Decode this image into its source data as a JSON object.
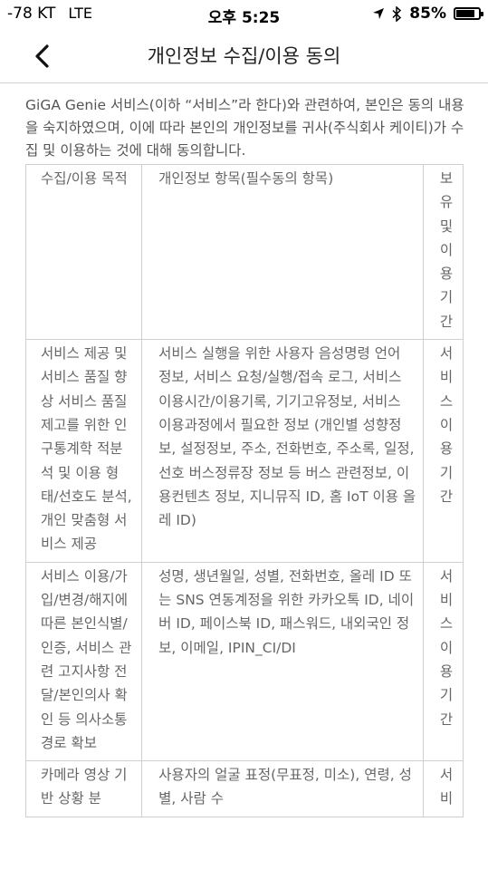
{
  "status_bar": {
    "signal": "-78 KT",
    "network": "LTE",
    "time": "오후 5:25",
    "battery": "85%",
    "battery_level": 0.85
  },
  "nav": {
    "title": "개인정보 수집/이용 동의"
  },
  "intro": "GiGA Genie 서비스(이하 “서비스”라 한다)와 관련하여, 본인은 동의 내용을 숙지하였으며, 이에 따라 본인의 개인정보를 귀사(주식회사 케이티)가 수집 및 이용하는 것에 대해 동의합니다.",
  "table": {
    "headers": [
      "수집/이용 목적",
      "개인정보 항목(필수동의 항목)",
      "보유 및 이용 기간"
    ],
    "rows": [
      {
        "purpose": "서비스 제공 및 서비스 품질 향상 서비스 품질 제고를 위한 인구통계학 적분석 및 이용 형태/선호도 분석, 개인 맞춤형 서비스 제공",
        "items": "서비스 실행을 위한 사용자 음성명령 언어 정보, 서비스 요청/실행/접속 로그, 서비스 이용시간/이용기록, 기기고유정보, 서비스 이용과정에서 필요한 정보 (개인별 성향정보, 설정정보, 주소, 전화번호, 주소록, 일정, 선호 버스정류장 정보 등 버스 관련정보, 이용컨텐츠 정보, 지니뮤직 ID, 홈 IoT 이용 올레 ID)",
        "period": "서비스 이용기간"
      },
      {
        "purpose": "서비스 이용/가입/변경/해지에 따른 본인식별/인증, 서비스 관련 고지사항 전달/본인의사 확인 등 의사소통 경로 확보",
        "items": "성명, 생년월일, 성별, 전화번호, 올레 ID 또는 SNS 연동계정을 위한 카카오톡 ID, 네이버 ID, 페이스북 ID, 패스워드, 내외국인 정보, 이메일, IPIN_CI/DI",
        "period": "서비스 이용기간"
      },
      {
        "purpose": "카메라 영상 기반 상황 분",
        "items": "사용자의 얼굴 표정(무표정, 미소), 연령, 성별, 사람 수",
        "period": "서비"
      }
    ]
  }
}
